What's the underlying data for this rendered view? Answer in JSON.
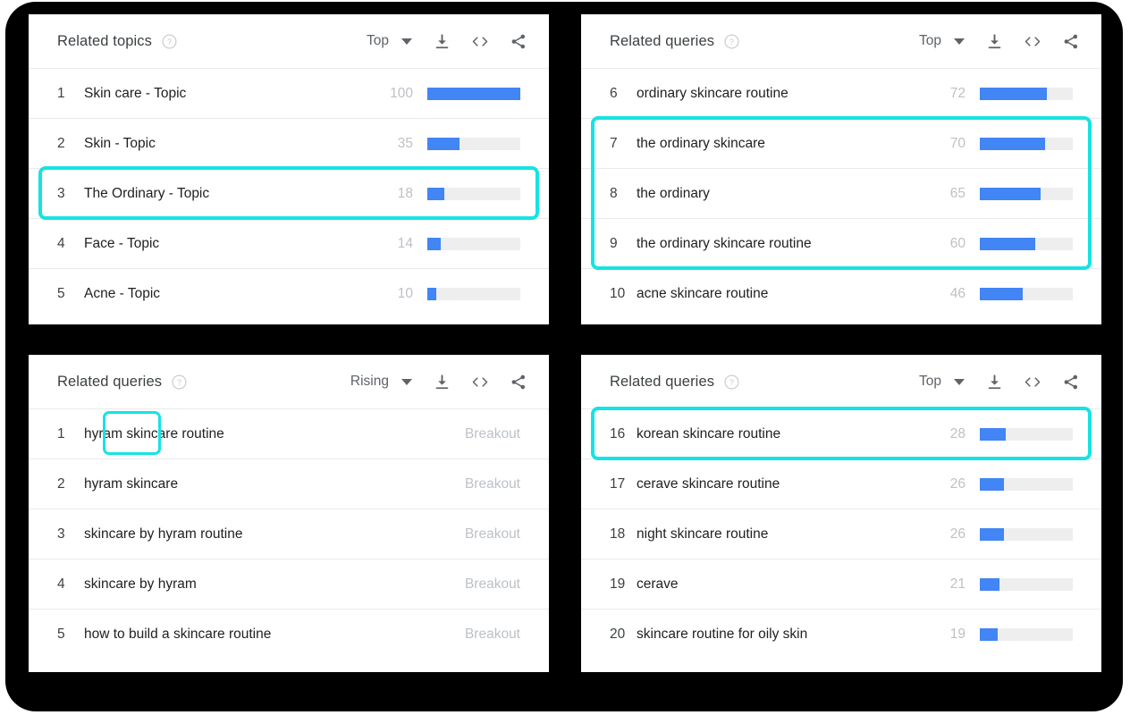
{
  "theme": {
    "bar_color": "#4285f4",
    "track_color": "#eeeeee",
    "highlight_color": "#16e3e3",
    "backdrop_color": "#000000"
  },
  "panels": [
    {
      "id": "related-topics-top",
      "title": "Related topics",
      "sort": "Top",
      "value_type": "bar",
      "rows": [
        {
          "rank": "1",
          "label": "Skin care - Topic",
          "value": "100",
          "pct": 100,
          "highlighted": false
        },
        {
          "rank": "2",
          "label": "Skin - Topic",
          "value": "35",
          "pct": 35,
          "highlighted": false
        },
        {
          "rank": "3",
          "label": "The Ordinary - Topic",
          "value": "18",
          "pct": 18,
          "highlighted": true
        },
        {
          "rank": "4",
          "label": "Face - Topic",
          "value": "14",
          "pct": 14,
          "highlighted": false
        },
        {
          "rank": "5",
          "label": "Acne - Topic",
          "value": "10",
          "pct": 10,
          "highlighted": false
        }
      ]
    },
    {
      "id": "related-queries-top-6-10",
      "title": "Related queries",
      "sort": "Top",
      "value_type": "bar",
      "rows": [
        {
          "rank": "6",
          "label": "ordinary skincare routine",
          "value": "72",
          "pct": 72,
          "highlighted": false
        },
        {
          "rank": "7",
          "label": "the ordinary skincare",
          "value": "70",
          "pct": 70,
          "highlighted": true
        },
        {
          "rank": "8",
          "label": "the ordinary",
          "value": "65",
          "pct": 65,
          "highlighted": true
        },
        {
          "rank": "9",
          "label": "the ordinary skincare routine",
          "value": "60",
          "pct": 60,
          "highlighted": true
        },
        {
          "rank": "10",
          "label": "acne skincare routine",
          "value": "46",
          "pct": 46,
          "highlighted": false
        }
      ]
    },
    {
      "id": "related-queries-rising",
      "title": "Related queries",
      "sort": "Rising",
      "value_type": "text",
      "rows": [
        {
          "rank": "1",
          "label": "hyram skincare routine",
          "value": "Breakout",
          "highlighted": false,
          "highlight_word": "hyram"
        },
        {
          "rank": "2",
          "label": "hyram skincare",
          "value": "Breakout",
          "highlighted": false
        },
        {
          "rank": "3",
          "label": "skincare by hyram routine",
          "value": "Breakout",
          "highlighted": false
        },
        {
          "rank": "4",
          "label": "skincare by hyram",
          "value": "Breakout",
          "highlighted": false
        },
        {
          "rank": "5",
          "label": "how to build a skincare routine",
          "value": "Breakout",
          "highlighted": false
        }
      ]
    },
    {
      "id": "related-queries-top-16-20",
      "title": "Related queries",
      "sort": "Top",
      "value_type": "bar",
      "rows": [
        {
          "rank": "16",
          "label": "korean skincare routine",
          "value": "28",
          "pct": 28,
          "highlighted": true
        },
        {
          "rank": "17",
          "label": "cerave skincare routine",
          "value": "26",
          "pct": 26,
          "highlighted": false
        },
        {
          "rank": "18",
          "label": "night skincare routine",
          "value": "26",
          "pct": 26,
          "highlighted": false
        },
        {
          "rank": "19",
          "label": "cerave",
          "value": "21",
          "pct": 21,
          "highlighted": false
        },
        {
          "rank": "20",
          "label": "skincare routine for oily skin",
          "value": "19",
          "pct": 19,
          "highlighted": false
        }
      ]
    }
  ],
  "icons": {
    "help": "help-circle-icon",
    "caret": "chevron-down-icon",
    "download": "download-icon",
    "embed": "embed-code-icon",
    "share": "share-icon"
  }
}
